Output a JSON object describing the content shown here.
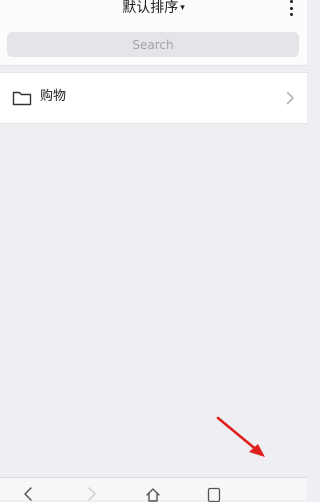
{
  "header": {
    "sort_label": "默认排序",
    "sort_caret": "▾",
    "more_icon": "more-vertical-icon"
  },
  "search": {
    "placeholder": "Search"
  },
  "folders": [
    {
      "label": "购物",
      "icon": "folder-icon",
      "chevron": "chevron-right-icon"
    }
  ],
  "annotation": {
    "arrow_color": "#e0201c"
  },
  "bottom_nav": {
    "items": [
      "back-icon",
      "forward-icon",
      "home-icon",
      "pages-icon"
    ]
  }
}
